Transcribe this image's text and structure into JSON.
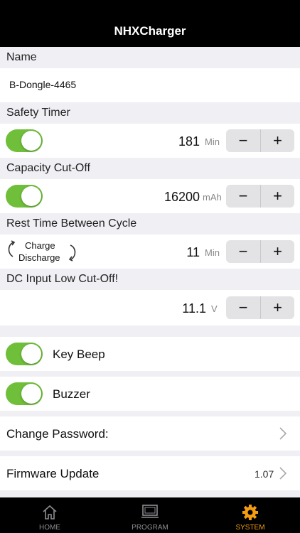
{
  "navbar": {
    "title": "NHXCharger"
  },
  "name_section": {
    "header": "Name",
    "value": "B-Dongle-4465"
  },
  "safety_timer": {
    "header": "Safety Timer",
    "value": "181",
    "unit": "Min",
    "enabled": true,
    "minus": "−",
    "plus": "+"
  },
  "capacity_cutoff": {
    "header": "Capacity Cut-Off",
    "value": "16200",
    "unit": "mAh",
    "enabled": true,
    "minus": "−",
    "plus": "+"
  },
  "rest_time": {
    "header": "Rest Time Between Cycle",
    "mode_line1": "Charge",
    "mode_line2": "Discharge",
    "value": "11",
    "unit": "Min",
    "minus": "−",
    "plus": "+"
  },
  "dc_input": {
    "header": "DC Input Low Cut-Off!",
    "value": "11.1",
    "unit": "V",
    "minus": "−",
    "plus": "+"
  },
  "key_beep": {
    "label": "Key Beep",
    "enabled": true
  },
  "buzzer": {
    "label": "Buzzer",
    "enabled": true
  },
  "change_password": {
    "label": "Change Password:"
  },
  "firmware": {
    "label": "Firmware Update",
    "value": "1.07"
  },
  "tabs": [
    {
      "label": "HOME",
      "icon": "home-icon"
    },
    {
      "label": "PROGRAM",
      "icon": "monitor-icon"
    },
    {
      "label": "SYSTEM",
      "icon": "gear-icon",
      "active": true
    }
  ],
  "colors": {
    "toggle_on": "#6fbf3a",
    "active_tab": "#f39c12",
    "navbar": "#000000"
  }
}
